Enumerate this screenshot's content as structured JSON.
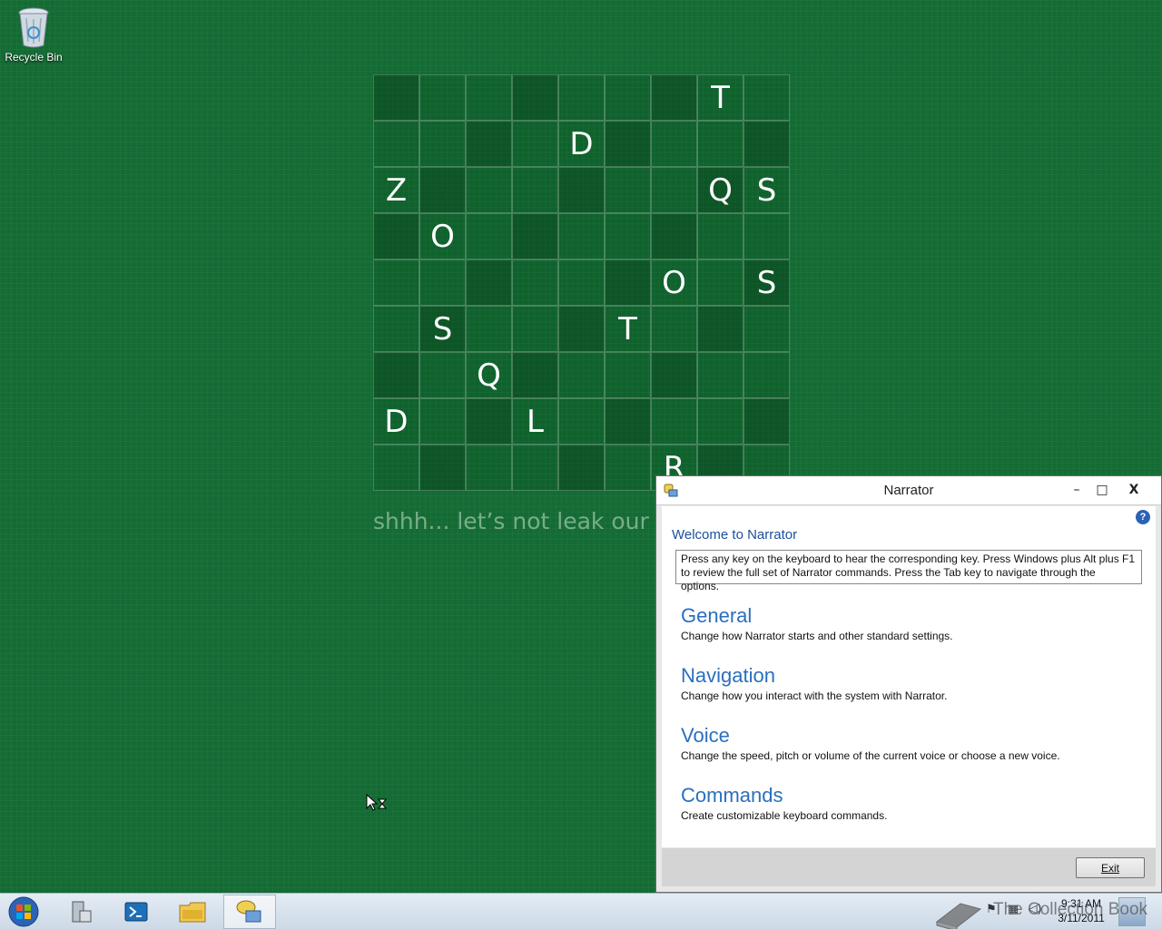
{
  "desktop": {
    "icons": [
      {
        "label": "Recycle Bin",
        "icon": "recycle-bin-icon"
      }
    ],
    "caption": "shhh... let’s not leak our"
  },
  "grid": {
    "rows": [
      [
        "",
        "",
        "",
        "",
        "",
        "",
        "",
        "T",
        ""
      ],
      [
        "",
        "",
        "",
        "",
        "D",
        "",
        "",
        "",
        ""
      ],
      [
        "Z",
        "",
        "",
        "",
        "",
        "",
        "",
        "Q",
        "S"
      ],
      [
        "",
        "O",
        "",
        "",
        "",
        "",
        "",
        "",
        ""
      ],
      [
        "",
        "",
        "",
        "",
        "",
        "",
        "O",
        "",
        "S"
      ],
      [
        "",
        "S",
        "",
        "",
        "",
        "T",
        "",
        "",
        ""
      ],
      [
        "",
        "",
        "Q",
        "",
        "",
        "",
        "",
        "",
        ""
      ],
      [
        "D",
        "",
        "",
        "L",
        "",
        "",
        "",
        "",
        ""
      ],
      [
        "",
        "",
        "",
        "",
        "",
        "",
        "R",
        "",
        ""
      ]
    ]
  },
  "narrator": {
    "title": "Narrator",
    "welcome": "Welcome to Narrator",
    "info": "Press any key on the keyboard to hear the corresponding key. Press Windows plus Alt plus F1 to review the full set of Narrator commands. Press the Tab key to navigate through the options.",
    "options": [
      {
        "heading": "General",
        "desc": "Change how Narrator starts and other standard settings."
      },
      {
        "heading": "Navigation",
        "desc": "Change how you interact with the system with Narrator."
      },
      {
        "heading": "Voice",
        "desc": "Change the speed, pitch or volume of the current voice or choose a new voice."
      },
      {
        "heading": "Commands",
        "desc": "Create customizable keyboard commands."
      }
    ],
    "exit_label": "Exit",
    "help_glyph": "?",
    "controls": {
      "min": "–",
      "max": "□",
      "close": "X"
    }
  },
  "taskbar": {
    "items": [
      "server-manager-icon",
      "powershell-icon",
      "file-explorer-icon",
      "narrator-icon"
    ],
    "active_index": 3,
    "clock_time": "9:31 AM",
    "clock_date": "3/11/2011",
    "tray": [
      "flag-icon",
      "network-icon",
      "volume-icon"
    ]
  },
  "watermark": {
    "text": "The Collection Book"
  },
  "colors": {
    "desktop": "#146b33",
    "accent_blue": "#2a6fbe"
  }
}
